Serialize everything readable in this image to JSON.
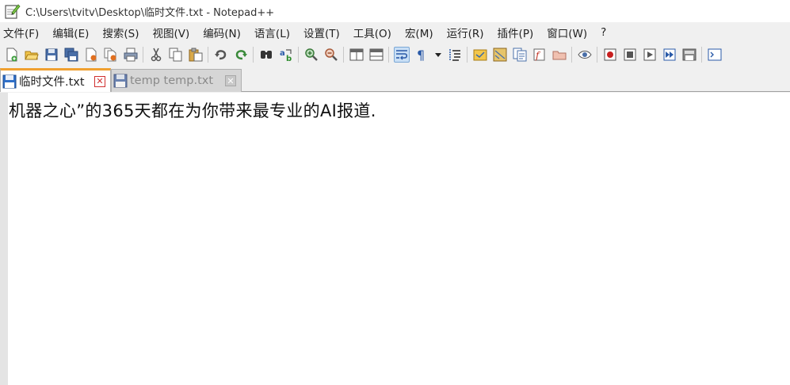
{
  "window": {
    "title": "C:\\Users\\tvitv\\Desktop\\临时文件.txt - Notepad++",
    "app_icon": "notepad-plus-icon"
  },
  "menu": [
    {
      "label": "文件(F)"
    },
    {
      "label": "编辑(E)"
    },
    {
      "label": "搜索(S)"
    },
    {
      "label": "视图(V)"
    },
    {
      "label": "编码(N)"
    },
    {
      "label": "语言(L)"
    },
    {
      "label": "设置(T)"
    },
    {
      "label": "工具(O)"
    },
    {
      "label": "宏(M)"
    },
    {
      "label": "运行(R)"
    },
    {
      "label": "插件(P)"
    },
    {
      "label": "窗口(W)"
    },
    {
      "label": "?"
    }
  ],
  "toolbar": {
    "icons": [
      "new-file-icon",
      "open-file-icon",
      "save-icon",
      "save-all-icon",
      "close-icon",
      "close-all-icon",
      "print-icon",
      "cut-icon",
      "copy-icon",
      "paste-icon",
      "undo-icon",
      "redo-icon",
      "find-icon",
      "replace-icon",
      "zoom-in-icon",
      "zoom-out-icon",
      "sync-vertical-icon",
      "sync-horizontal-icon",
      "word-wrap-icon",
      "show-all-characters-icon",
      "indent-guide-icon",
      "user-defined-language-icon",
      "document-map-icon",
      "function-list-icon",
      "folder-as-workspace-icon",
      "monitoring-icon",
      "record-macro-icon",
      "stop-recording-icon",
      "playback-macro-icon",
      "run-macro-multiple-icon",
      "save-macro-icon",
      "console-icon"
    ],
    "active_icon": "word-wrap-icon"
  },
  "tabs": [
    {
      "label": "临时文件.txt",
      "active": true
    },
    {
      "label": "temp temp.txt",
      "active": false
    }
  ],
  "editor": {
    "lines": [
      "机器之心”的365天都在为你带来最专业的AI报道."
    ]
  },
  "colors": {
    "active_tab_accent": "#f0a030",
    "close_active": "#d03030",
    "editor_bg": "#ffffff",
    "gutter_bg": "#e4e4e4"
  }
}
